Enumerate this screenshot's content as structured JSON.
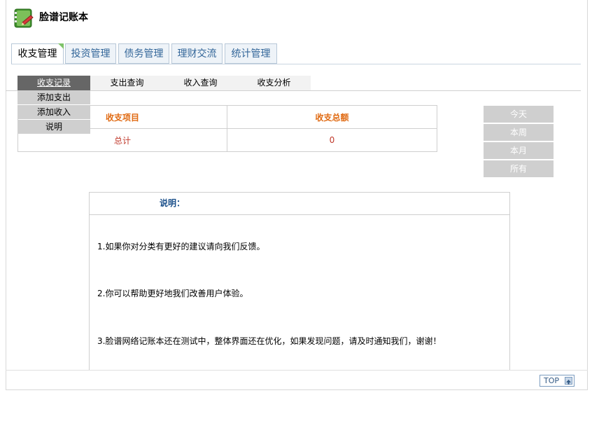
{
  "header": {
    "title": "脸谱记账本",
    "logo_icon": "notebook-icon"
  },
  "tabs": [
    {
      "label": "收支管理",
      "active": true
    },
    {
      "label": "投资管理",
      "active": false
    },
    {
      "label": "债务管理",
      "active": false
    },
    {
      "label": "理财交流",
      "active": false
    },
    {
      "label": "统计管理",
      "active": false
    }
  ],
  "subtabs": [
    {
      "label": "收支记录",
      "active": true
    },
    {
      "label": "支出查询",
      "active": false
    },
    {
      "label": "收入查询",
      "active": false
    },
    {
      "label": "收支分析",
      "active": false
    }
  ],
  "dropdown": [
    "添加支出",
    "添加收入",
    "说明"
  ],
  "summary": {
    "headers": [
      "收支项目",
      "收支总额"
    ],
    "row": [
      "总计",
      "0"
    ]
  },
  "periods": [
    "今天",
    "本周",
    "本月",
    "所有"
  ],
  "note": {
    "title": "说明：",
    "lines": [
      "1.如果你对分类有更好的建议请向我们反馈。",
      "2.你可以帮助更好地我们改善用户体验。",
      "3.脸谱网络记账本还在测试中，整体界面还在优化，如果发现问题，请及时通知我们，谢谢！"
    ]
  },
  "footer": {
    "top_label": "TOP",
    "top_icon": "arrow-up-icon"
  },
  "colors": {
    "accent_orange": "#e06a12",
    "link_blue": "#336699",
    "tab_green": "#7ec36a"
  }
}
